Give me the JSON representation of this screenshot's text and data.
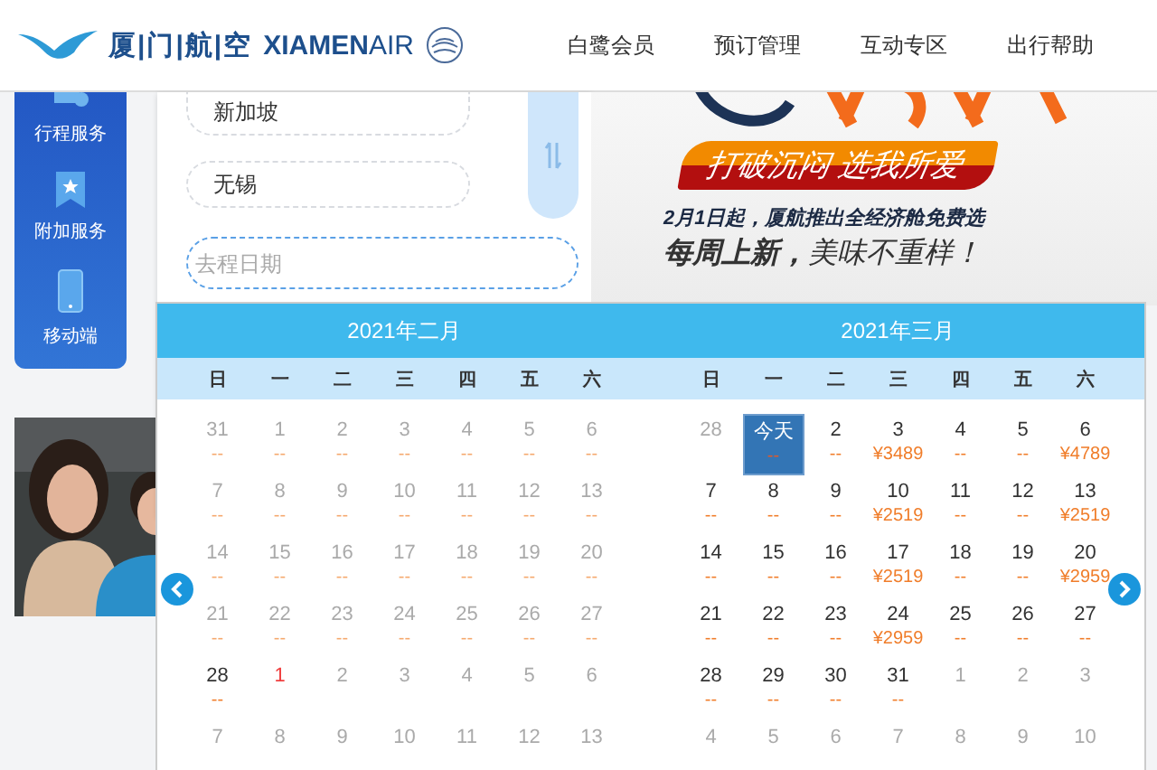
{
  "header": {
    "brand_cn": "厦|门|航|空",
    "brand_en": "**XIAMEN**AIR",
    "nav": [
      "白鹭会员",
      "预订管理",
      "互动专区",
      "出行帮助"
    ]
  },
  "sidebar": {
    "items": [
      {
        "label": "行程服务"
      },
      {
        "label": "附加服务"
      },
      {
        "label": "移动端"
      }
    ]
  },
  "search_form": {
    "fields": [
      {
        "value": "新加坡"
      },
      {
        "value": "无锡"
      }
    ],
    "date_field": {
      "placeholder": "去程日期"
    }
  },
  "banner": {
    "slogan": "打破沉闷 选我所爱",
    "line1": "2月1日起，厦航推出全经济舱**免费选**",
    "line2": "**每周上新，**美味不重样！"
  },
  "calendar": {
    "months": [
      {
        "title": "2021年二月",
        "weekdays": [
          "日",
          "一",
          "二",
          "三",
          "四",
          "五",
          "六"
        ],
        "days": [
          {
            "date": "31",
            "price": "--",
            "kind": "past"
          },
          {
            "date": "1",
            "price": "--",
            "kind": "past"
          },
          {
            "date": "2",
            "price": "--",
            "kind": "past"
          },
          {
            "date": "3",
            "price": "--",
            "kind": "past"
          },
          {
            "date": "4",
            "price": "--",
            "kind": "past"
          },
          {
            "date": "5",
            "price": "--",
            "kind": "past"
          },
          {
            "date": "6",
            "price": "--",
            "kind": "past"
          },
          {
            "date": "7",
            "price": "--",
            "kind": "past"
          },
          {
            "date": "8",
            "price": "--",
            "kind": "past"
          },
          {
            "date": "9",
            "price": "--",
            "kind": "past"
          },
          {
            "date": "10",
            "price": "--",
            "kind": "past"
          },
          {
            "date": "11",
            "price": "--",
            "kind": "past"
          },
          {
            "date": "12",
            "price": "--",
            "kind": "past"
          },
          {
            "date": "13",
            "price": "--",
            "kind": "past"
          },
          {
            "date": "14",
            "price": "--",
            "kind": "past"
          },
          {
            "date": "15",
            "price": "--",
            "kind": "past"
          },
          {
            "date": "16",
            "price": "--",
            "kind": "past"
          },
          {
            "date": "17",
            "price": "--",
            "kind": "past"
          },
          {
            "date": "18",
            "price": "--",
            "kind": "past"
          },
          {
            "date": "19",
            "price": "--",
            "kind": "past"
          },
          {
            "date": "20",
            "price": "--",
            "kind": "past"
          },
          {
            "date": "21",
            "price": "--",
            "kind": "past"
          },
          {
            "date": "22",
            "price": "--",
            "kind": "past"
          },
          {
            "date": "23",
            "price": "--",
            "kind": "past"
          },
          {
            "date": "24",
            "price": "--",
            "kind": "past"
          },
          {
            "date": "25",
            "price": "--",
            "kind": "past"
          },
          {
            "date": "26",
            "price": "--",
            "kind": "past"
          },
          {
            "date": "27",
            "price": "--",
            "kind": "past"
          },
          {
            "date": "28",
            "price": "--",
            "kind": "open"
          },
          {
            "date": "1",
            "kind": "holiday"
          },
          {
            "date": "2",
            "kind": "other"
          },
          {
            "date": "3",
            "kind": "other"
          },
          {
            "date": "4",
            "kind": "other"
          },
          {
            "date": "5",
            "kind": "other"
          },
          {
            "date": "6",
            "kind": "other"
          },
          {
            "date": "7",
            "kind": "other"
          },
          {
            "date": "8",
            "kind": "other"
          },
          {
            "date": "9",
            "kind": "other"
          },
          {
            "date": "10",
            "kind": "other"
          },
          {
            "date": "11",
            "kind": "other"
          },
          {
            "date": "12",
            "kind": "other"
          },
          {
            "date": "13",
            "kind": "other"
          }
        ]
      },
      {
        "title": "2021年三月",
        "weekdays": [
          "日",
          "一",
          "二",
          "三",
          "四",
          "五",
          "六"
        ],
        "days": [
          {
            "date": "28",
            "kind": "other"
          },
          {
            "date": "今天",
            "price": "--",
            "kind": "today"
          },
          {
            "date": "2",
            "price": "--",
            "kind": "open"
          },
          {
            "date": "3",
            "price": "¥3489",
            "kind": "open"
          },
          {
            "date": "4",
            "price": "--",
            "kind": "open"
          },
          {
            "date": "5",
            "price": "--",
            "kind": "open"
          },
          {
            "date": "6",
            "price": "¥4789",
            "kind": "open"
          },
          {
            "date": "7",
            "price": "--",
            "kind": "open"
          },
          {
            "date": "8",
            "price": "--",
            "kind": "open"
          },
          {
            "date": "9",
            "price": "--",
            "kind": "open"
          },
          {
            "date": "10",
            "price": "¥2519",
            "kind": "open"
          },
          {
            "date": "11",
            "price": "--",
            "kind": "open"
          },
          {
            "date": "12",
            "price": "--",
            "kind": "open"
          },
          {
            "date": "13",
            "price": "¥2519",
            "kind": "open"
          },
          {
            "date": "14",
            "price": "--",
            "kind": "open"
          },
          {
            "date": "15",
            "price": "--",
            "kind": "open"
          },
          {
            "date": "16",
            "price": "--",
            "kind": "open"
          },
          {
            "date": "17",
            "price": "¥2519",
            "kind": "open"
          },
          {
            "date": "18",
            "price": "--",
            "kind": "open"
          },
          {
            "date": "19",
            "price": "--",
            "kind": "open"
          },
          {
            "date": "20",
            "price": "¥2959",
            "kind": "open"
          },
          {
            "date": "21",
            "price": "--",
            "kind": "open"
          },
          {
            "date": "22",
            "price": "--",
            "kind": "open"
          },
          {
            "date": "23",
            "price": "--",
            "kind": "open"
          },
          {
            "date": "24",
            "price": "¥2959",
            "kind": "open"
          },
          {
            "date": "25",
            "price": "--",
            "kind": "open"
          },
          {
            "date": "26",
            "price": "--",
            "kind": "open"
          },
          {
            "date": "27",
            "price": "--",
            "kind": "open"
          },
          {
            "date": "28",
            "price": "--",
            "kind": "open"
          },
          {
            "date": "29",
            "price": "--",
            "kind": "open"
          },
          {
            "date": "30",
            "price": "--",
            "kind": "open"
          },
          {
            "date": "31",
            "price": "--",
            "kind": "open"
          },
          {
            "date": "1",
            "kind": "other"
          },
          {
            "date": "2",
            "kind": "other"
          },
          {
            "date": "3",
            "kind": "other"
          },
          {
            "date": "4",
            "kind": "other"
          },
          {
            "date": "5",
            "kind": "other"
          },
          {
            "date": "6",
            "kind": "other"
          },
          {
            "date": "7",
            "kind": "other"
          },
          {
            "date": "8",
            "kind": "other"
          },
          {
            "date": "9",
            "kind": "other"
          },
          {
            "date": "10",
            "kind": "other"
          }
        ]
      }
    ]
  }
}
